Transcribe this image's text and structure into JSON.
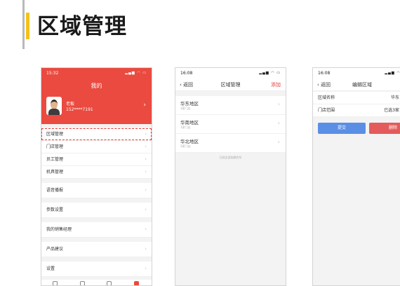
{
  "page": {
    "title": "区域管理"
  },
  "phone1": {
    "time": "15:32",
    "title": "我的",
    "user": {
      "name": "老板",
      "phone": "152****7191"
    },
    "menu_groups": [
      [
        "区域管理",
        "门店管理",
        "员工管理",
        "机具管理"
      ],
      [
        "语音播报"
      ],
      [
        "参数设置"
      ],
      [
        "我的销售经理"
      ],
      [
        "产品建议"
      ],
      [
        "设置"
      ]
    ]
  },
  "phone2": {
    "time": "16:08",
    "back": "返回",
    "title": "区域管理",
    "add": "添加",
    "regions": [
      {
        "name": "华东地区",
        "sub": "3家门店"
      },
      {
        "name": "华南地区",
        "sub": "1家门店"
      },
      {
        "name": "华北地区",
        "sub": "3家门店"
      }
    ],
    "end_text": "已经全部加载完毕"
  },
  "phone3": {
    "time": "16:08",
    "back": "返回",
    "title": "编辑区域",
    "fields": [
      {
        "label": "区域名称",
        "value": "华东"
      },
      {
        "label": "门店范围",
        "value": "已选3家"
      }
    ],
    "submit": "提交",
    "delete": "删除"
  },
  "colors": {
    "accent_red": "#ea4a3f",
    "title_bar": "#f3c21a",
    "submit_blue": "#5b8fe6",
    "delete_red": "#e35b5b"
  }
}
